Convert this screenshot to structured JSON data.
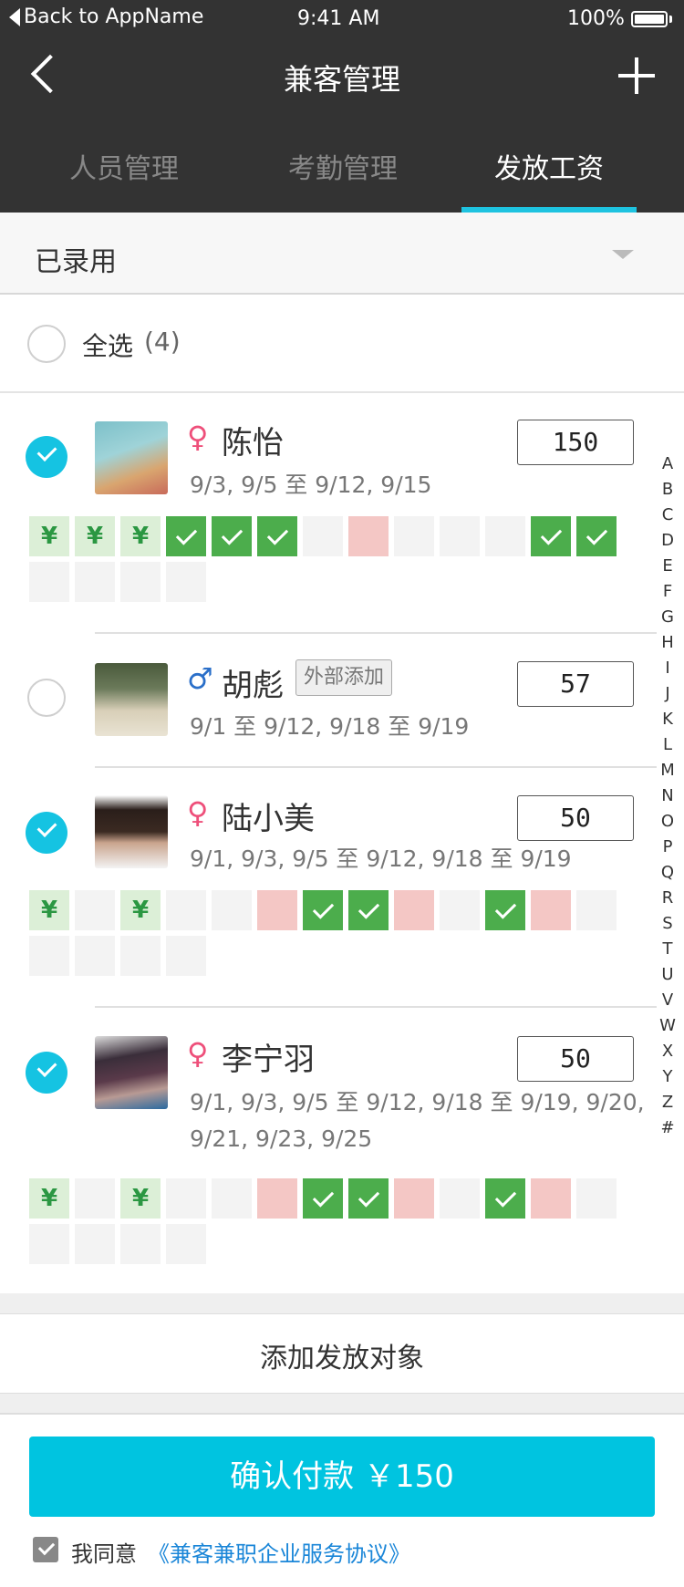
{
  "status_bar": {
    "back_app": "Back to AppName",
    "time": "9:41 AM",
    "battery": "100%"
  },
  "nav": {
    "title": "兼客管理"
  },
  "tabs": [
    {
      "label": "人员管理"
    },
    {
      "label": "考勤管理"
    },
    {
      "label": "发放工资",
      "active": true
    }
  ],
  "filter": {
    "selected": "已录用"
  },
  "select_all": {
    "label": "全选",
    "count": "(4)"
  },
  "people": [
    {
      "name": "陈怡",
      "gender": "female",
      "gender_symbol": "♀",
      "dates_line1": "9/3, 9/5 至 9/12, 9/15",
      "dates_line2": "",
      "amount": "150",
      "checked": true,
      "external_badge": "",
      "avatar_colors": [
        "#7cc0c9",
        "#d9a56f"
      ],
      "cells": [
        "yen",
        "yen",
        "yen",
        "check",
        "check",
        "check",
        "empty",
        "absent",
        "empty",
        "empty",
        "empty",
        "check",
        "check",
        "empty",
        "empty",
        "empty",
        "empty"
      ]
    },
    {
      "name": "胡彪",
      "gender": "male",
      "gender_symbol": "♂",
      "dates_line1": "9/1 至 9/12, 9/18 至 9/19",
      "dates_line2": "",
      "amount": "57",
      "checked": false,
      "external_badge": "外部添加",
      "avatar_colors": [
        "#4a5a3c",
        "#d8cfb8"
      ],
      "cells": []
    },
    {
      "name": "陆小美",
      "gender": "female",
      "gender_symbol": "♀",
      "dates_line1": "9/1, 9/3, 9/5 至 9/12, 9/18 至 9/19",
      "dates_line2": "",
      "amount": "50",
      "checked": true,
      "external_badge": "",
      "avatar_colors": [
        "#2a1e1a",
        "#c9a48d"
      ],
      "cells": [
        "yen",
        "empty",
        "yen",
        "empty",
        "empty",
        "absent",
        "check",
        "check",
        "absent",
        "empty",
        "check",
        "absent",
        "empty",
        "empty",
        "empty",
        "empty",
        "empty"
      ]
    },
    {
      "name": "李宁羽",
      "gender": "female",
      "gender_symbol": "♀",
      "dates_line1": "9/1, 9/3, 9/5 至 9/12, 9/18 至 9/19, 9/20,",
      "dates_line2": "9/21, 9/23, 9/25",
      "amount": "50",
      "checked": true,
      "external_badge": "",
      "avatar_colors": [
        "#3a2e3a",
        "#b89a94"
      ],
      "cells": [
        "yen",
        "empty",
        "yen",
        "empty",
        "empty",
        "absent",
        "check",
        "check",
        "absent",
        "empty",
        "check",
        "absent",
        "empty",
        "empty",
        "empty",
        "empty",
        "empty"
      ]
    }
  ],
  "cell_symbols": {
    "yen": "¥"
  },
  "alphabet": [
    "A",
    "B",
    "C",
    "D",
    "E",
    "F",
    "G",
    "H",
    "I",
    "J",
    "K",
    "L",
    "M",
    "N",
    "O",
    "P",
    "Q",
    "R",
    "S",
    "T",
    "U",
    "V",
    "W",
    "X",
    "Y",
    "Z",
    "#"
  ],
  "footer": {
    "add_label": "添加发放对象",
    "confirm_label": "确认付款 ￥150",
    "agree_prefix": "我同意",
    "agree_link": "《兼客兼职企业服务协议》"
  },
  "colors": {
    "accent": "#00c4e0",
    "header_bg": "#333333",
    "check_green": "#4cad4c",
    "absent_pink": "#f4c7c5",
    "yen_bg": "#dcefd7"
  }
}
